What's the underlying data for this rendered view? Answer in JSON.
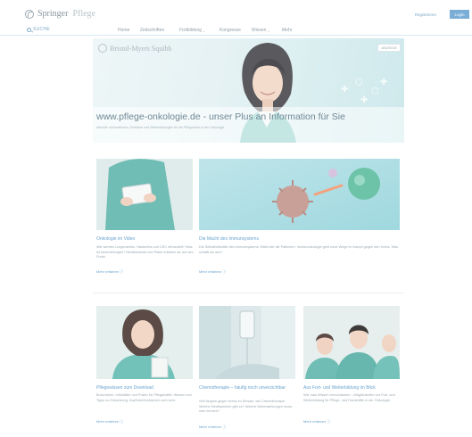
{
  "header": {
    "brand": "Springer",
    "brand_sub": "Pflege",
    "register_label": "Registrieren",
    "login_label": "Login"
  },
  "nav": {
    "search_label": "SUCHE",
    "items": [
      {
        "label": "Home",
        "has_menu": false
      },
      {
        "label": "Zeitschriften",
        "has_menu": false
      },
      {
        "label": "Fortbildung",
        "has_menu": true
      },
      {
        "label": "Kongresse",
        "has_menu": false
      },
      {
        "label": "Wissen",
        "has_menu": true
      },
      {
        "label": "Mehr",
        "has_menu": false
      }
    ]
  },
  "hero": {
    "sponsor": "Bristol-Myers Squibb",
    "badge": "ANZEIGE",
    "title": "www.pflege-onkologie.de - unser Plus an Information für Sie",
    "subtitle": "Aktuelle Informationen, Einblicke und Weiterbildungen für die Pflegenden in der Onkologie"
  },
  "cards_top": [
    {
      "title": "Onkologie im Video",
      "text": "Wie werden Lungenkrebs, Hautkrebs und CRC behandelt? Was ist Immuntherapie? Medikamente und Pläne erklären sie auf den Punkt.",
      "link": "Mehr erfahren ⓘ"
    },
    {
      "title": "Die Macht des Immunsystems",
      "text": "Die Selbstheilkräfte des Immunsystems: Mittel wie die Patienten. Immunonkologie geht neue Wege im Kampf gegen den Krebs. Was schafft sie aus?",
      "link": "Mehr erfahren ⓘ"
    }
  ],
  "cards_bottom": [
    {
      "title": "Pflegewissen zum Download",
      "text": "Broschüren, Infoblätter und Poster für Pflegekräfte: Wissen und Tipps zu Erkrankung, Kopfhörerfunktionen und mehr.",
      "link": "Mehr erfahren ⓘ"
    },
    {
      "title": "Chemotherapie – häufig noch unverzichtbar",
      "text": "Seit langem gegen Krebs im Einsatz: wie Chemotherapie. Welche Medikamente gibt es? Welche Nebenwirkungen muss man kennen?",
      "link": "Mehr erfahren ⓘ"
    },
    {
      "title": "Aus Fort- und Weiterbildung im Blick",
      "text": "Wie man Wissen verschränken – Möglichkeiten zur Fort- und Weiterbildung für Pflege- und Fachkräfte in der Onkologie.",
      "link": "Mehr erfahren ⓘ"
    }
  ]
}
